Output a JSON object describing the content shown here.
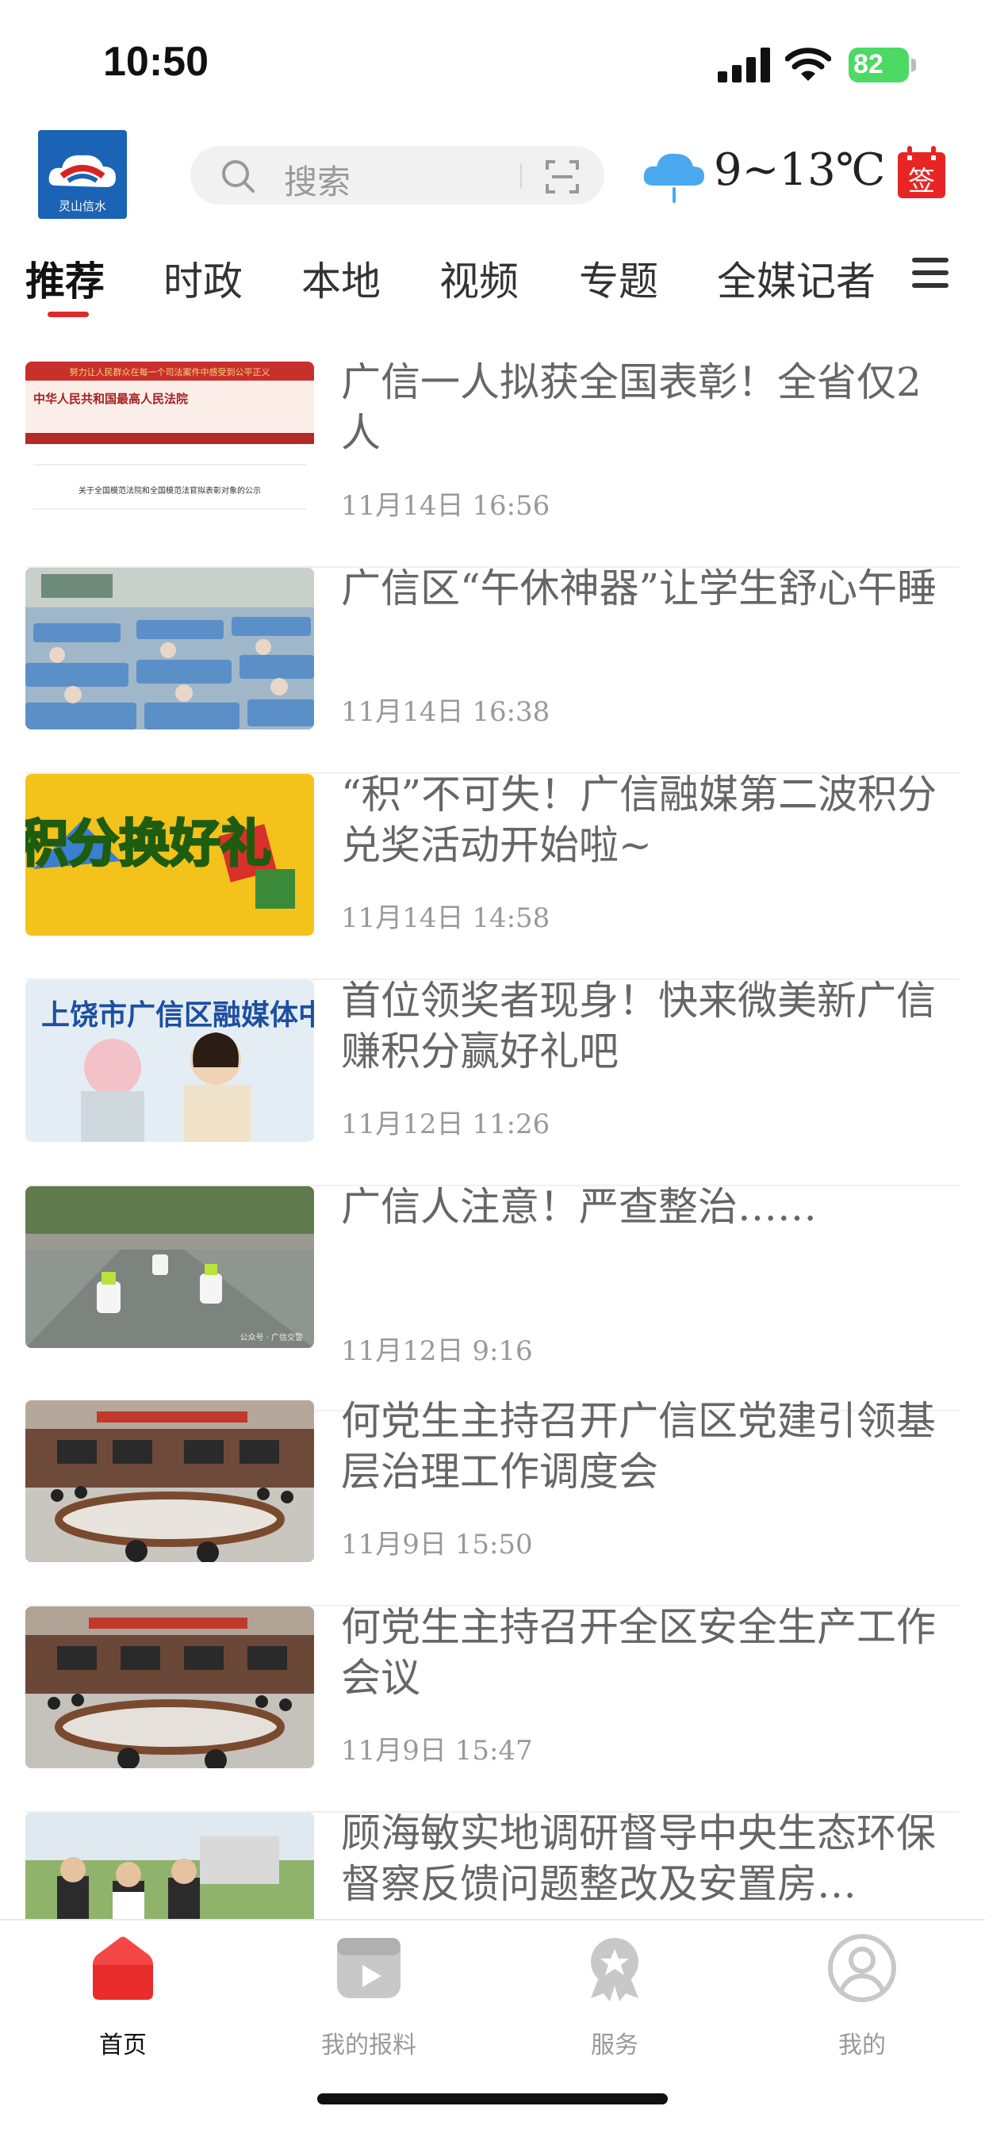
{
  "status_bar": {
    "time": "10:50",
    "battery": "82"
  },
  "header": {
    "logo_text": "灵山信水",
    "search_placeholder": "搜索",
    "weather": "9~13℃",
    "sign_label": "签"
  },
  "tabs": [
    {
      "label": "推荐",
      "active": true
    },
    {
      "label": "时政"
    },
    {
      "label": "本地"
    },
    {
      "label": "视频"
    },
    {
      "label": "专题"
    },
    {
      "label": "全媒记者"
    }
  ],
  "news": [
    {
      "title": "广信一人拟获全国表彰！全省仅2人",
      "date": "11月14日  16:56",
      "thumb": "court-website"
    },
    {
      "title": "广信区“午休神器”让学生舒心午睡",
      "date": "11月14日  16:38",
      "thumb": "classroom-nap"
    },
    {
      "title": "“积”不可失！广信融媒第二波积分兑奖活动开始啦~",
      "date": "11月14日  14:58",
      "thumb": "points-gift"
    },
    {
      "title": "首位领奖者现身！快来微美新广信赚积分赢好礼吧",
      "date": "11月12日  11:26",
      "thumb": "prize-winner"
    },
    {
      "title": "广信人注意！严查整治……",
      "date": "11月12日  9:16",
      "thumb": "police-motorcycles"
    },
    {
      "title": "何党生主持召开广信区党建引领基层治理工作调度会",
      "date": "11月9日  15:50",
      "thumb": "meeting-room"
    },
    {
      "title": "何党生主持召开全区安全生产工作会议",
      "date": "11月9日  15:47",
      "thumb": "meeting-room-2"
    },
    {
      "title": "顾海敏实地调研督导中央生态环保督察反馈问题整改及安置房…",
      "date": "",
      "thumb": "site-inspection"
    }
  ],
  "thumb_texts": {
    "court_banner": "努力让人民群众在每一个司法案件中感受到公平正义",
    "court_name": "中华人民共和国最高人民法院",
    "court_notice": "关于全国模范法院和全国模范法官拟表彰对象的公示",
    "points": "积分换好礼",
    "center_sign": "上饶市广信区融媒体中心",
    "watermark": "公众号 · 广信交警"
  },
  "bottom_nav": [
    {
      "label": "首页",
      "icon": "home-icon",
      "active": true
    },
    {
      "label": "我的报料",
      "icon": "report-icon"
    },
    {
      "label": "服务",
      "icon": "service-icon"
    },
    {
      "label": "我的",
      "icon": "profile-icon"
    }
  ],
  "colors": {
    "accent": "#e02929",
    "title": "#666666",
    "date": "#999999"
  }
}
